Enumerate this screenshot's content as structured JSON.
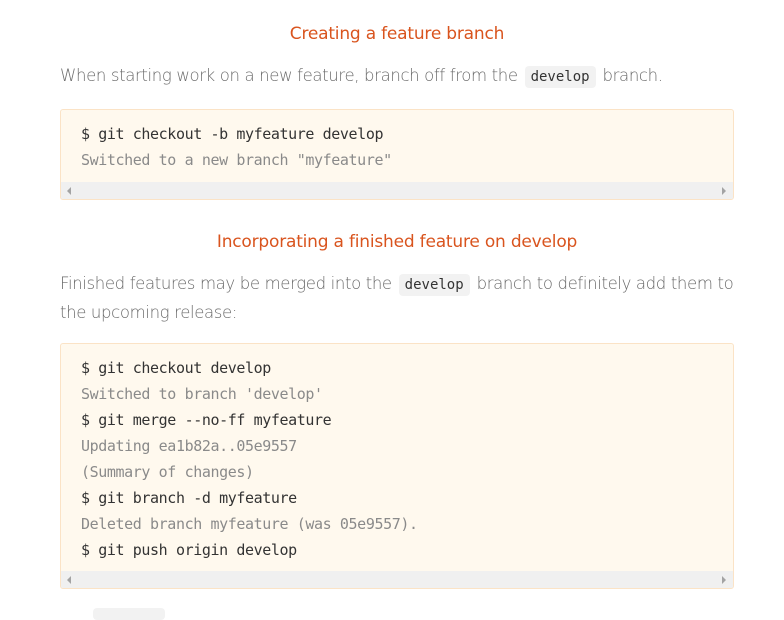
{
  "sections": [
    {
      "heading": "Creating a feature branch",
      "paragraph": {
        "before": "When starting work on a new feature, branch off from the",
        "code": "develop",
        "after": "branch."
      },
      "code_lines": [
        {
          "type": "command",
          "text": "$ git checkout -b myfeature develop"
        },
        {
          "type": "output",
          "text": "Switched to a new branch \"myfeature\""
        }
      ]
    },
    {
      "heading": "Incorporating a finished feature on develop",
      "paragraph": {
        "before": "Finished features may be merged into the",
        "code": "develop",
        "after": "branch to definitely add them to the upcoming release:"
      },
      "code_lines": [
        {
          "type": "command",
          "text": "$ git checkout develop"
        },
        {
          "type": "output",
          "text": "Switched to branch 'develop'"
        },
        {
          "type": "command",
          "text": "$ git merge --no-ff myfeature"
        },
        {
          "type": "output",
          "text": "Updating ea1b82a..05e9557"
        },
        {
          "type": "output",
          "text": "(Summary of changes)"
        },
        {
          "type": "command",
          "text": "$ git branch -d myfeature"
        },
        {
          "type": "output",
          "text": "Deleted branch myfeature (was 05e9557)."
        },
        {
          "type": "command",
          "text": "$ git push origin develop"
        }
      ]
    }
  ],
  "colors": {
    "heading": "#d9541e",
    "body_text": "#6b6b6b",
    "code_bg": "#fff9ee",
    "code_border": "#fbe3c6",
    "command": "#333333",
    "output": "#8a8a8a",
    "inline_code_bg": "#f2f2f2"
  }
}
